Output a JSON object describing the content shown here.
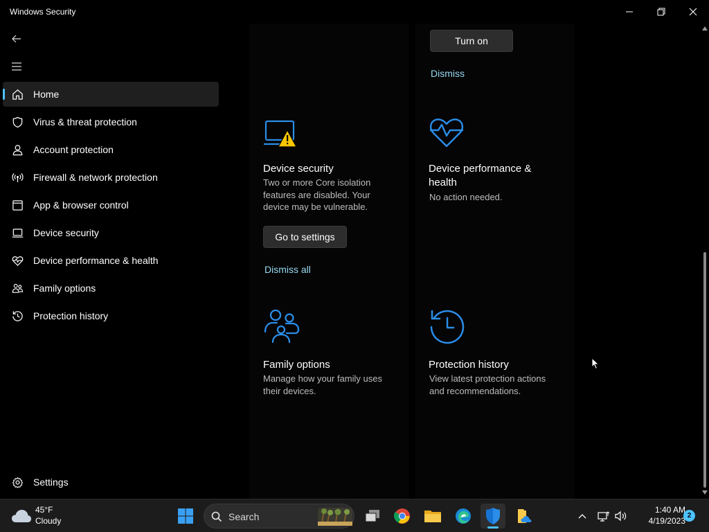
{
  "window": {
    "title": "Windows Security",
    "controls": [
      "minimize",
      "restore",
      "close"
    ]
  },
  "sidebar": {
    "items": [
      {
        "label": "Home",
        "icon": "home-icon",
        "active": true
      },
      {
        "label": "Virus & threat protection",
        "icon": "shield-icon"
      },
      {
        "label": "Account protection",
        "icon": "person-icon"
      },
      {
        "label": "Firewall & network protection",
        "icon": "antenna-icon"
      },
      {
        "label": "App & browser control",
        "icon": "window-icon"
      },
      {
        "label": "Device security",
        "icon": "laptop-icon"
      },
      {
        "label": "Device performance & health",
        "icon": "heart-pulse-icon"
      },
      {
        "label": "Family options",
        "icon": "family-icon"
      },
      {
        "label": "Protection history",
        "icon": "history-icon"
      }
    ],
    "settings_label": "Settings"
  },
  "main": {
    "top_partial": {
      "button_label": "Turn on",
      "dismiss_label": "Dismiss"
    },
    "cards": {
      "device_security": {
        "title": "Device security",
        "desc_lines": [
          "Two or more Core isolation",
          "features are disabled.  Your",
          "device may be vulnerable."
        ],
        "button_label": "Go to settings",
        "dismiss_label": "Dismiss all",
        "icon": "laptop-warning-icon"
      },
      "device_performance": {
        "title_lines": [
          "Device performance &",
          "health"
        ],
        "desc": "No action needed.",
        "icon": "heart-pulse-icon"
      },
      "family_options": {
        "title": "Family options",
        "desc_lines": [
          "Manage how your family uses",
          "their devices."
        ],
        "icon": "family-icon"
      },
      "protection_history": {
        "title": "Protection history",
        "desc_lines": [
          "View latest protection actions",
          "and recommendations."
        ],
        "icon": "history-icon"
      }
    }
  },
  "taskbar": {
    "weather": {
      "temp": "45°F",
      "condition": "Cloudy"
    },
    "search_label": "Search",
    "clock": {
      "time": "1:40 AM",
      "date": "4/19/2023"
    },
    "notification_count": "2",
    "colors": {
      "accent": "#4cc2ff",
      "link": "#99d9f2",
      "icon_blue": "#2b8de8"
    }
  }
}
